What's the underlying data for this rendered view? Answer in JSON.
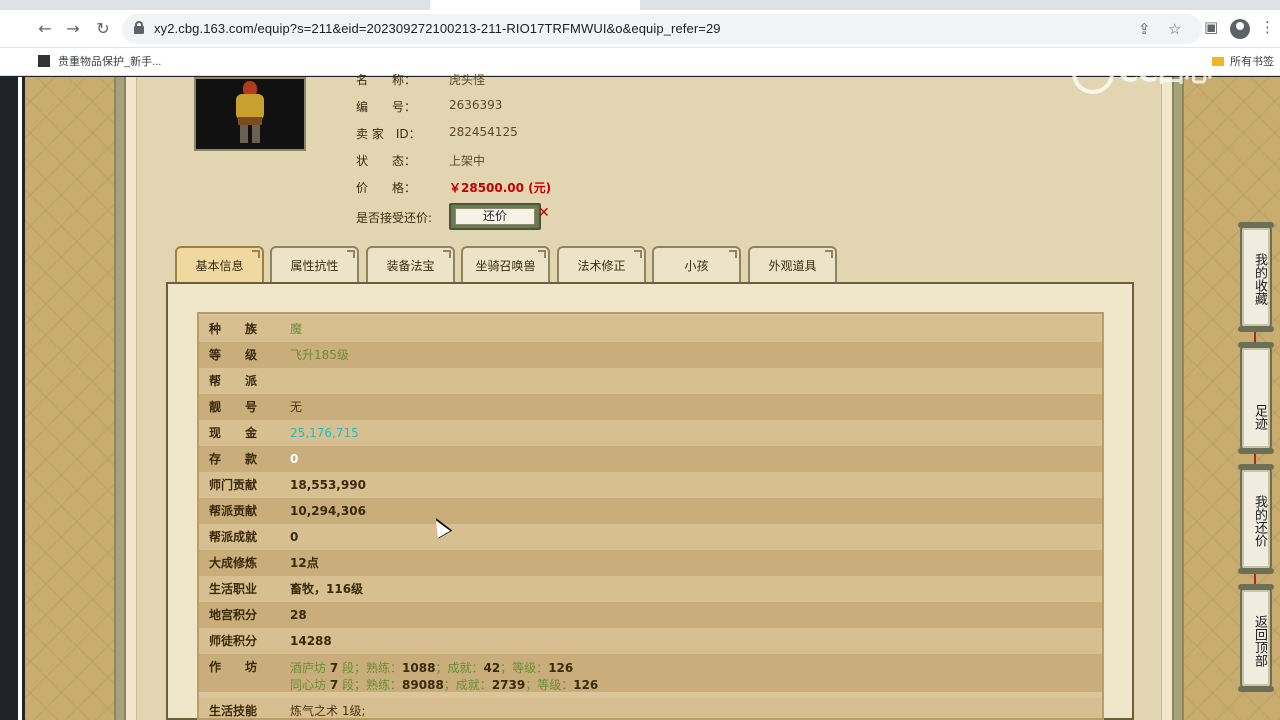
{
  "browser": {
    "url": "xy2.cbg.163.com/equip?s=211&eid=202309272100213-211-RIO17TRFMWUI&o&equip_refer=29",
    "bookmark_label": "贵重物品保护_新手...",
    "bookmarks_right_label": "所有书签"
  },
  "watermark": {
    "text": "CC西心"
  },
  "equip_info": {
    "name_label": "名　　称：",
    "name_value": "虎头怪",
    "id_label": "编　　号：",
    "id_value": "2636393",
    "seller_label": "卖 家　ID：",
    "seller_value": "282454125",
    "status_label": "状　　态：",
    "status_value": "上架中",
    "price_label": "价　　格：",
    "price_value": "￥28500.00 (元)",
    "counter_label": "是否接受还价:",
    "counter_button": "还价"
  },
  "tabs": [
    {
      "label": "基本信息",
      "active": true
    },
    {
      "label": "属性抗性",
      "active": false
    },
    {
      "label": "装备法宝",
      "active": false
    },
    {
      "label": "坐骑召唤兽",
      "active": false
    },
    {
      "label": "法术修正",
      "active": false
    },
    {
      "label": "小孩",
      "active": false
    },
    {
      "label": "外观道具",
      "active": false
    }
  ],
  "basic_info": [
    {
      "label": "种　　族",
      "value": "魔",
      "style": "green"
    },
    {
      "label": "等　　级",
      "value": "飞升185级",
      "style": "green"
    },
    {
      "label": "帮　　派",
      "value": "",
      "style": "brown"
    },
    {
      "label": "靓　　号",
      "value": "无",
      "style": "brown"
    },
    {
      "label": "现　　金",
      "value": "25,176,715",
      "style": "cyan"
    },
    {
      "label": "存　　款",
      "value": "0",
      "style": "bold-white"
    },
    {
      "label": "师门贡献",
      "value": "18,553,990",
      "style": "bold"
    },
    {
      "label": "帮派贡献",
      "value": "10,294,306",
      "style": "bold"
    },
    {
      "label": "帮派成就",
      "value": "0",
      "style": "bold"
    },
    {
      "label": "大成修炼",
      "value": "12点",
      "style": "bold"
    },
    {
      "label": "生活职业",
      "value": "畜牧，116级",
      "style": "bold"
    },
    {
      "label": "地宫积分",
      "value": "28",
      "style": "bold"
    },
    {
      "label": "师徒积分",
      "value": "14288",
      "style": "bold"
    }
  ],
  "workshop": {
    "label": "作　　坊",
    "line1": {
      "name": "酒庐坊",
      "level": "7",
      "level_unit": "段；熟练：",
      "skill": "1088",
      "achievement_label": "；成就：",
      "achievement": "42",
      "grade_label": "；等级：",
      "grade": "126"
    },
    "line2": {
      "name": "同心坊",
      "level": "7",
      "level_unit": "段；熟练：",
      "skill": "89088",
      "achievement_label": "；成就：",
      "achievement": "2739",
      "grade_label": "；等级：",
      "grade": "126"
    }
  },
  "life_skill": {
    "label": "生活技能",
    "value": "炼气之术 1级;"
  },
  "side_buttons": [
    {
      "label": "我的收藏"
    },
    {
      "label": "足迹"
    },
    {
      "label": "我的还价"
    },
    {
      "label": "返回顶部"
    }
  ],
  "colors": {
    "page_bg": "#c9ad6e",
    "price": "#c20000",
    "value_green": "#6b8e3a",
    "value_cyan": "#1ec0c0"
  }
}
